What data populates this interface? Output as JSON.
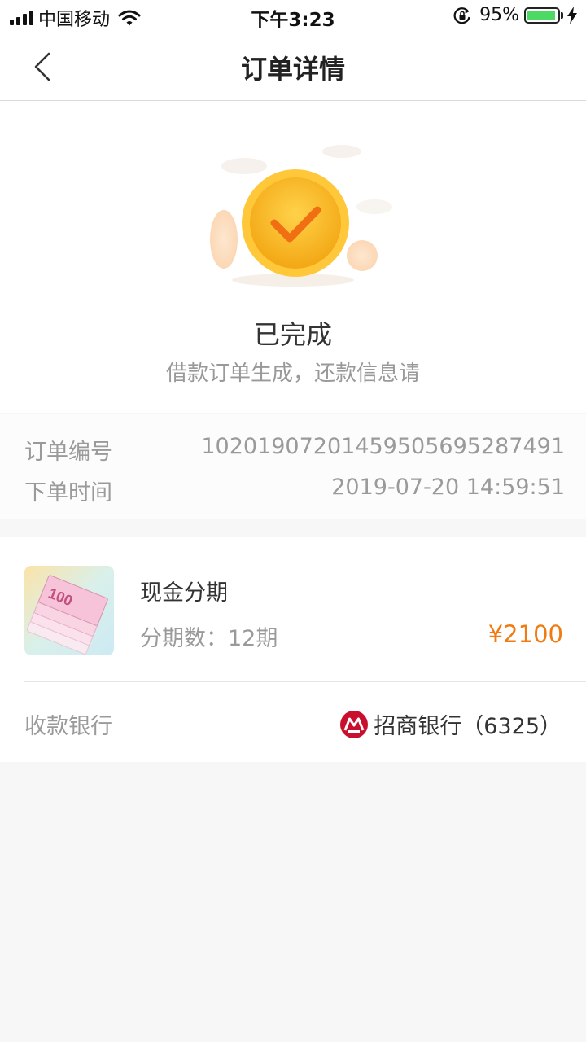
{
  "status_bar": {
    "carrier": "中国移动",
    "time": "下午3:23",
    "battery_percent": "95%",
    "battery_level": 0.95,
    "icons": [
      "signal-icon",
      "wifi-icon",
      "rotation-lock-icon",
      "battery-icon",
      "charging-icon"
    ]
  },
  "nav": {
    "title": "订单详情",
    "back_icon": "chevron-left-icon"
  },
  "order_status": {
    "title": "已完成",
    "subtitle": "借款订单生成，还款信息请",
    "icon": "checkmark-coin-icon",
    "accent_color": "#f5b722"
  },
  "order_info": {
    "order_number_label": "订单编号",
    "order_number": "10201907201459505695287491",
    "order_time_label": "下单时间",
    "order_time": "2019-07-20 14:59:51"
  },
  "product": {
    "name": "现金分期",
    "period_text": "分期数：12期",
    "price": "¥2100",
    "price_color": "#f07b10",
    "thumb_icon": "cash-banknotes-icon",
    "banknote_denomination": "100"
  },
  "bank": {
    "label": "收款银行",
    "name": "招商银行（6325）",
    "logo": "cmb-bank-logo-icon",
    "logo_color": "#c8102e"
  }
}
